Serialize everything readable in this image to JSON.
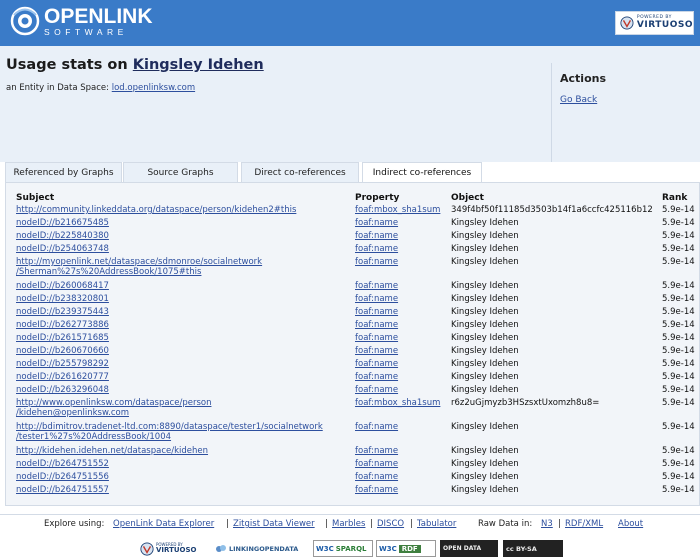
{
  "header": {
    "logo_line1": "OPENLINK",
    "logo_line2": "SOFTWARE",
    "badge_powered": "POWERED BY",
    "badge_name": "VIRTUOSO"
  },
  "page": {
    "title_prefix": "Usage stats on",
    "title_entity": "Kingsley Idehen",
    "subtitle_prefix": "an Entity in Data Space:",
    "subtitle_link": "lod.openlinksw.com"
  },
  "actions": {
    "heading": "Actions",
    "go_back": "Go Back"
  },
  "tabs": [
    {
      "label": "Referenced by Graphs",
      "active": false
    },
    {
      "label": "Source Graphs",
      "active": false
    },
    {
      "label": "Direct co-references",
      "active": false
    },
    {
      "label": "Indirect co-references",
      "active": true
    }
  ],
  "table": {
    "headers": [
      "Subject",
      "Property",
      "Object",
      "Rank"
    ],
    "rows": [
      {
        "subject": "http://community.linkeddata.org/dataspace/person/kidehen2#this",
        "subject2": "",
        "property": "foaf:mbox_sha1sum",
        "object": "349f4bf50f11185d3503b14f1a6ccfc425116b12",
        "rank": "5.9e-14"
      },
      {
        "subject": "nodeID://b216675485",
        "subject2": "",
        "property": "foaf:name",
        "object": "Kingsley Idehen",
        "rank": "5.9e-14"
      },
      {
        "subject": "nodeID://b225840380",
        "subject2": "",
        "property": "foaf:name",
        "object": "Kingsley Idehen",
        "rank": "5.9e-14"
      },
      {
        "subject": "nodeID://b254063748",
        "subject2": "",
        "property": "foaf:name",
        "object": "Kingsley Idehen",
        "rank": "5.9e-14"
      },
      {
        "subject": "http://myopenlink.net/dataspace/sdmonroe/socialnetwork",
        "subject2": "/Sherman%27s%20AddressBook/1075#this",
        "property": "foaf:name",
        "object": "Kingsley Idehen",
        "rank": "5.9e-14"
      },
      {
        "subject": "nodeID://b260068417",
        "subject2": "",
        "property": "foaf:name",
        "object": "Kingsley Idehen",
        "rank": "5.9e-14"
      },
      {
        "subject": "nodeID://b238320801",
        "subject2": "",
        "property": "foaf:name",
        "object": "Kingsley Idehen",
        "rank": "5.9e-14"
      },
      {
        "subject": "nodeID://b239375443",
        "subject2": "",
        "property": "foaf:name",
        "object": "Kingsley Idehen",
        "rank": "5.9e-14"
      },
      {
        "subject": "nodeID://b262773886",
        "subject2": "",
        "property": "foaf:name",
        "object": "Kingsley Idehen",
        "rank": "5.9e-14"
      },
      {
        "subject": "nodeID://b261571685",
        "subject2": "",
        "property": "foaf:name",
        "object": "Kingsley Idehen",
        "rank": "5.9e-14"
      },
      {
        "subject": "nodeID://b260670660",
        "subject2": "",
        "property": "foaf:name",
        "object": "Kingsley Idehen",
        "rank": "5.9e-14"
      },
      {
        "subject": "nodeID://b255798292",
        "subject2": "",
        "property": "foaf:name",
        "object": "Kingsley Idehen",
        "rank": "5.9e-14"
      },
      {
        "subject": "nodeID://b261620777",
        "subject2": "",
        "property": "foaf:name",
        "object": "Kingsley Idehen",
        "rank": "5.9e-14"
      },
      {
        "subject": "nodeID://b263296048",
        "subject2": "",
        "property": "foaf:name",
        "object": "Kingsley Idehen",
        "rank": "5.9e-14"
      },
      {
        "subject": "http://www.openlinksw.com/dataspace/person",
        "subject2": "/kidehen@openlinksw.com",
        "property": "foaf:mbox_sha1sum",
        "object": "r6z2uGjmyzb3HSzsxtUxomzh8u8=",
        "rank": "5.9e-14"
      },
      {
        "subject": "http://bdimitrov.tradenet-ltd.com:8890/dataspace/tester1/socialnetwork",
        "subject2": "/tester1%27s%20AddressBook/1004",
        "property": "foaf:name",
        "object": "Kingsley Idehen",
        "rank": "5.9e-14"
      },
      {
        "subject": "http://kidehen.idehen.net/dataspace/kidehen",
        "subject2": "",
        "property": "foaf:name",
        "object": "Kingsley Idehen",
        "rank": "5.9e-14"
      },
      {
        "subject": "nodeID://b264751552",
        "subject2": "",
        "property": "foaf:name",
        "object": "Kingsley Idehen",
        "rank": "5.9e-14"
      },
      {
        "subject": "nodeID://b264751556",
        "subject2": "",
        "property": "foaf:name",
        "object": "Kingsley Idehen",
        "rank": "5.9e-14"
      },
      {
        "subject": "nodeID://b264751557",
        "subject2": "",
        "property": "foaf:name",
        "object": "Kingsley Idehen",
        "rank": "5.9e-14"
      }
    ]
  },
  "footer": {
    "explore_label": "Explore using:",
    "explore_links": [
      "OpenLink Data Explorer",
      "Zitgist Data Viewer",
      "Marbles",
      "DISCO",
      "Tabulator"
    ],
    "separator": "|",
    "raw_label": "Raw Data in:",
    "raw_links": [
      "N3",
      "RDF/XML"
    ],
    "about": "About",
    "logos": {
      "virtuoso_powered": "POWERED BY",
      "virtuoso_name": "VIRTUOSO",
      "lod": "LINKINGOPENDATA",
      "w3c_sparql_a": "W3C",
      "w3c_sparql_b": "SPARQL",
      "w3c_rdf_a": "W3C",
      "w3c_rdf_b": "RDF",
      "opendata": "OPEN DATA",
      "cc": "cc BY-SA"
    }
  },
  "colors": {
    "header_blue": "#3a7bc8",
    "link_blue": "#2d4f9e",
    "pale_blue": "#e9f0f8"
  }
}
